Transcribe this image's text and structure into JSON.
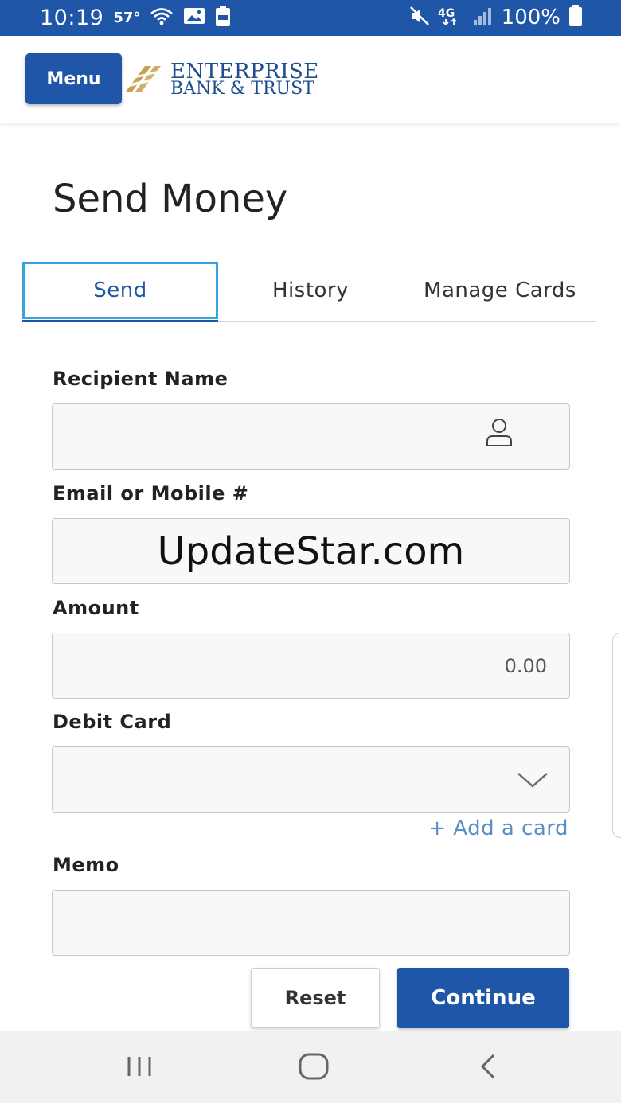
{
  "status_bar": {
    "time": "10:19",
    "temperature": "57°",
    "battery_text": "100%",
    "network": "4G",
    "icons": [
      "wifi-icon",
      "gallery-icon",
      "battery-saver-icon",
      "mute-icon",
      "signal-icon",
      "battery-icon"
    ],
    "background_color": "#1f56a8"
  },
  "header": {
    "menu_label": "Menu",
    "logo_line1": "ENTERPRISE",
    "logo_line2": "BANK & TRUST"
  },
  "page": {
    "title": "Send Money"
  },
  "tabs": [
    {
      "label": "Send",
      "active": true
    },
    {
      "label": "History",
      "active": false
    },
    {
      "label": "Manage Cards",
      "active": false
    }
  ],
  "form": {
    "recipient_name": {
      "label": "Recipient Name",
      "value": ""
    },
    "email_mobile": {
      "label": "Email or Mobile #",
      "value": "UpdateStar.com"
    },
    "amount": {
      "label": "Amount",
      "placeholder": "0.00"
    },
    "debit_card": {
      "label": "Debit Card",
      "value": ""
    },
    "add_card_label": "+ Add a card",
    "memo": {
      "label": "Memo",
      "value": ""
    }
  },
  "buttons": {
    "reset": "Reset",
    "continue": "Continue"
  },
  "colors": {
    "brand_blue": "#1f56a8",
    "tab_focus": "#36a3df",
    "link": "#5a8fc6",
    "logo_gold": "#c9a04e"
  }
}
